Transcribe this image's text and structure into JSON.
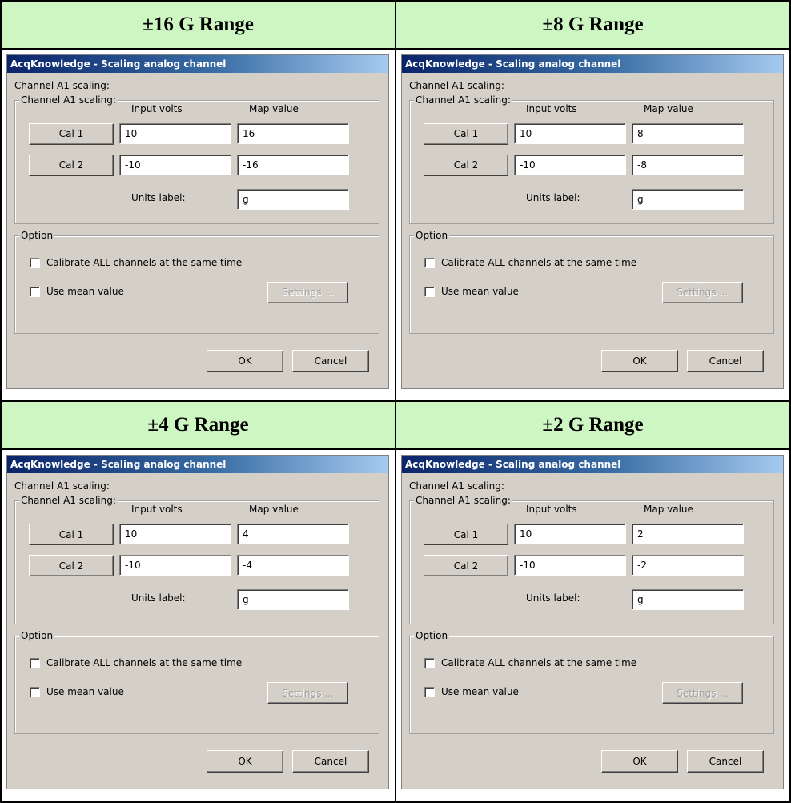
{
  "panels": [
    {
      "heading": "±16 G Range",
      "dialog": {
        "title": "AcqKnowledge - Scaling analog channel",
        "scaling_label": "Channel A1 scaling:",
        "scaling_group_label": "Channel A1 scaling:",
        "col_input_volts": "Input volts",
        "col_map_value": "Map value",
        "cal1_label": "Cal 1",
        "cal2_label": "Cal 2",
        "cal1_input": "10",
        "cal1_map": "16",
        "cal2_input": "-10",
        "cal2_map": "-16",
        "units_label": "Units label:",
        "units_value": "g",
        "option_group_label": "Option",
        "calibrate_all_label": "Calibrate ALL channels at the same time",
        "use_mean_label": "Use mean value",
        "settings_label": "Settings ...",
        "ok_label": "OK",
        "cancel_label": "Cancel"
      }
    },
    {
      "heading": "±8 G Range",
      "dialog": {
        "title": "AcqKnowledge - Scaling analog channel",
        "scaling_label": "Channel A1 scaling:",
        "scaling_group_label": "Channel A1 scaling:",
        "col_input_volts": "Input volts",
        "col_map_value": "Map value",
        "cal1_label": "Cal 1",
        "cal2_label": "Cal 2",
        "cal1_input": "10",
        "cal1_map": "8",
        "cal2_input": "-10",
        "cal2_map": "-8",
        "units_label": "Units label:",
        "units_value": "g",
        "option_group_label": "Option",
        "calibrate_all_label": "Calibrate ALL channels at the same time",
        "use_mean_label": "Use mean value",
        "settings_label": "Settings ...",
        "ok_label": "OK",
        "cancel_label": "Cancel"
      }
    },
    {
      "heading": "±4 G Range",
      "dialog": {
        "title": "AcqKnowledge - Scaling analog channel",
        "scaling_label": "Channel A1 scaling:",
        "scaling_group_label": "Channel A1 scaling:",
        "col_input_volts": "Input volts",
        "col_map_value": "Map value",
        "cal1_label": "Cal 1",
        "cal2_label": "Cal 2",
        "cal1_input": "10",
        "cal1_map": "4",
        "cal2_input": "-10",
        "cal2_map": "-4",
        "units_label": "Units label:",
        "units_value": "g",
        "option_group_label": "Option",
        "calibrate_all_label": "Calibrate ALL channels at the same time",
        "use_mean_label": "Use mean value",
        "settings_label": "Settings ...",
        "ok_label": "OK",
        "cancel_label": "Cancel"
      }
    },
    {
      "heading": "±2 G Range",
      "dialog": {
        "title": "AcqKnowledge - Scaling analog channel",
        "scaling_label": "Channel A1 scaling:",
        "scaling_group_label": "Channel A1 scaling:",
        "col_input_volts": "Input volts",
        "col_map_value": "Map value",
        "cal1_label": "Cal 1",
        "cal2_label": "Cal 2",
        "cal1_input": "10",
        "cal1_map": "2",
        "cal2_input": "-10",
        "cal2_map": "-2",
        "units_label": "Units label:",
        "units_value": "g",
        "option_group_label": "Option",
        "calibrate_all_label": "Calibrate ALL channels at the same time",
        "use_mean_label": "Use mean value",
        "settings_label": "Settings ...",
        "ok_label": "OK",
        "cancel_label": "Cancel"
      }
    }
  ],
  "colors": {
    "heading_bg": "#cdf6c2",
    "dialog_bg": "#d4d0c8",
    "titlebar_start": "#0a246a",
    "titlebar_end": "#a6caf0",
    "disabled_text": "#a0a0a0"
  }
}
